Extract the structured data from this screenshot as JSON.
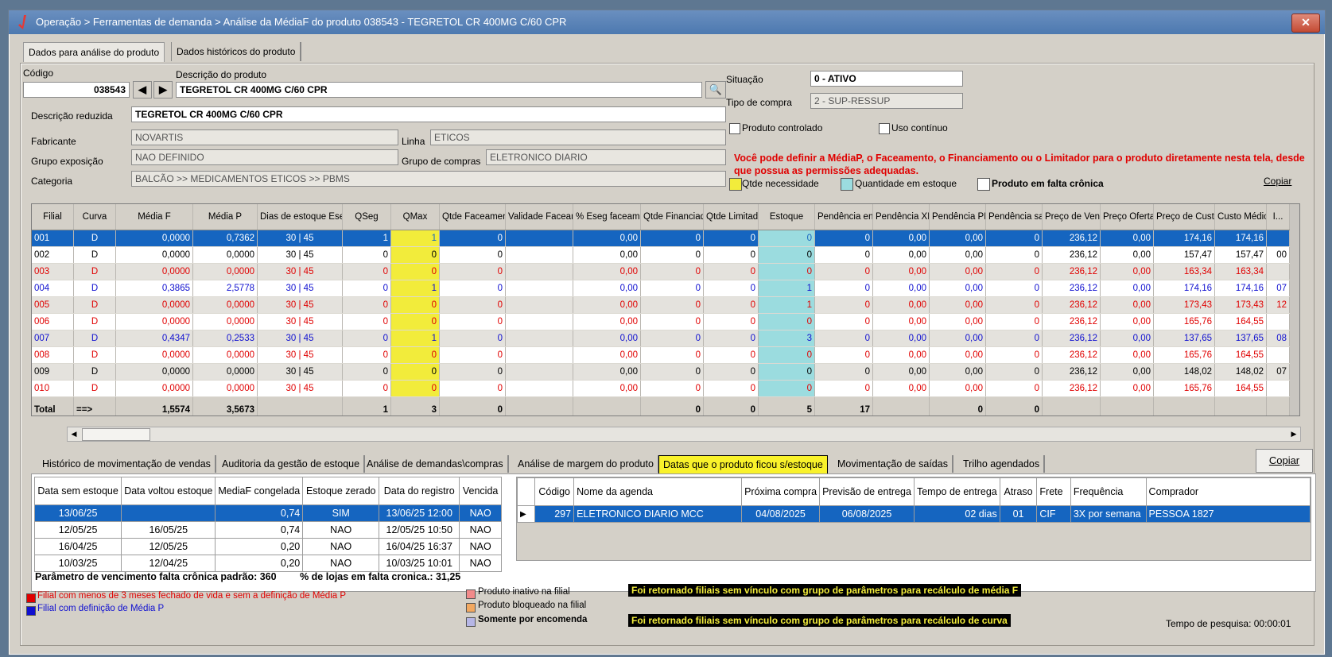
{
  "window": {
    "title": "Operação > Ferramentas de demanda > Análise da MédiaF do produto 038543 - TEGRETOL CR 400MG C/60 CPR",
    "close_label": "✕"
  },
  "top_tabs": [
    "Dados para análise do produto",
    "Dados históricos do produto"
  ],
  "product": {
    "codigo_label": "Código",
    "codigo": "038543",
    "descricao_label": "Descrição do produto",
    "descricao": "TEGRETOL CR 400MG C/60 CPR",
    "descricao_reduzida_label": "Descrição reduzida",
    "descricao_reduzida": "TEGRETOL CR 400MG C/60 CPR",
    "fabricante_label": "Fabricante",
    "fabricante": "NOVARTIS",
    "linha_label": "Linha",
    "linha": "ETICOS",
    "grupo_exposicao_label": "Grupo exposição",
    "grupo_exposicao": "NAO DEFINIDO",
    "grupo_compras_label": "Grupo de compras",
    "grupo_compras": "ELETRONICO DIARIO",
    "categoria_label": "Categoria",
    "categoria": "BALCÃO >> MEDICAMENTOS ETICOS >> PBMS",
    "situacao_label": "Situação",
    "situacao": "0 - ATIVO",
    "tipo_compra_label": "Tipo de compra",
    "tipo_compra": "2 - SUP-RESSUP",
    "produto_controlado_label": "Produto controlado",
    "produto_controlado_checked": false,
    "uso_continuo_label": "Uso contínuo",
    "uso_continuo_checked": false
  },
  "warning_text": "Você pode definir a MédiaP, o Faceamento, o Financiamento ou o Limitador para o produto diretamente nesta tela, desde que possua as permissões adequadas.",
  "grid_legend": {
    "qtde_necessidade": "Qtde necessidade",
    "quantidade_estoque": "Quantidade em estoque",
    "produto_falta": "Produto em falta crônica",
    "copiar": "Copiar",
    "yellow": "#f2ec3b",
    "cyan": "#9bdcdf"
  },
  "grid": {
    "columns": [
      "Filial",
      "Curva",
      "Média F",
      "Média P",
      "Dias de estoque Eseg | Emax",
      "QSeg",
      "QMax",
      "Qtde Faceamento",
      "Validade Faceamento",
      "% Eseg faceamento",
      "Qtde Financiado",
      "Qtde Limitada",
      "Estoque",
      "Pendência entrada",
      "Pendência XML",
      "Pendência PBM",
      "Pendência saída",
      "Preço de Venda",
      "Preço Oferta",
      "Preço de Custo",
      "Custo Médio",
      "I..."
    ],
    "rows": [
      {
        "color": "sel",
        "cells": [
          "001",
          "D",
          "0,0000",
          "0,7362",
          "30  |  45",
          "1",
          "1",
          "0",
          "",
          "0,00",
          "0",
          "0",
          "0",
          "0",
          "0,00",
          "0,00",
          "0",
          "236,12",
          "0,00",
          "174,16",
          "174,16",
          ""
        ]
      },
      {
        "color": "black",
        "cells": [
          "002",
          "D",
          "0,0000",
          "0,0000",
          "30  |  45",
          "0",
          "0",
          "0",
          "",
          "0,00",
          "0",
          "0",
          "0",
          "0",
          "0,00",
          "0,00",
          "0",
          "236,12",
          "0,00",
          "157,47",
          "157,47",
          "00"
        ]
      },
      {
        "color": "red",
        "cells": [
          "003",
          "D",
          "0,0000",
          "0,0000",
          "30  |  45",
          "0",
          "0",
          "0",
          "",
          "0,00",
          "0",
          "0",
          "0",
          "0",
          "0,00",
          "0,00",
          "0",
          "236,12",
          "0,00",
          "163,34",
          "163,34",
          ""
        ]
      },
      {
        "color": "blue",
        "cells": [
          "004",
          "D",
          "0,3865",
          "2,5778",
          "30  |  45",
          "0",
          "1",
          "0",
          "",
          "0,00",
          "0",
          "0",
          "1",
          "0",
          "0,00",
          "0,00",
          "0",
          "236,12",
          "0,00",
          "174,16",
          "174,16",
          "07"
        ]
      },
      {
        "color": "red",
        "cells": [
          "005",
          "D",
          "0,0000",
          "0,0000",
          "30  |  45",
          "0",
          "0",
          "0",
          "",
          "0,00",
          "0",
          "0",
          "1",
          "0",
          "0,00",
          "0,00",
          "0",
          "236,12",
          "0,00",
          "173,43",
          "173,43",
          "12"
        ]
      },
      {
        "color": "red",
        "cells": [
          "006",
          "D",
          "0,0000",
          "0,0000",
          "30  |  45",
          "0",
          "0",
          "0",
          "",
          "0,00",
          "0",
          "0",
          "0",
          "0",
          "0,00",
          "0,00",
          "0",
          "236,12",
          "0,00",
          "165,76",
          "164,55",
          ""
        ]
      },
      {
        "color": "blue",
        "cells": [
          "007",
          "D",
          "0,4347",
          "0,2533",
          "30  |  45",
          "0",
          "1",
          "0",
          "",
          "0,00",
          "0",
          "0",
          "3",
          "0",
          "0,00",
          "0,00",
          "0",
          "236,12",
          "0,00",
          "137,65",
          "137,65",
          "08"
        ]
      },
      {
        "color": "red",
        "cells": [
          "008",
          "D",
          "0,0000",
          "0,0000",
          "30  |  45",
          "0",
          "0",
          "0",
          "",
          "0,00",
          "0",
          "0",
          "0",
          "0",
          "0,00",
          "0,00",
          "0",
          "236,12",
          "0,00",
          "165,76",
          "164,55",
          ""
        ]
      },
      {
        "color": "black",
        "cells": [
          "009",
          "D",
          "0,0000",
          "0,0000",
          "30  |  45",
          "0",
          "0",
          "0",
          "",
          "0,00",
          "0",
          "0",
          "0",
          "0",
          "0,00",
          "0,00",
          "0",
          "236,12",
          "0,00",
          "148,02",
          "148,02",
          "07"
        ]
      },
      {
        "color": "red",
        "cells": [
          "010",
          "D",
          "0,0000",
          "0,0000",
          "30  |  45",
          "0",
          "0",
          "0",
          "",
          "0,00",
          "0",
          "0",
          "0",
          "0",
          "0,00",
          "0,00",
          "0",
          "236,12",
          "0,00",
          "165,76",
          "164,55",
          ""
        ]
      }
    ],
    "totals": [
      "Total",
      "==>",
      "1,5574",
      "3,5673",
      "",
      "1",
      "3",
      "0",
      "",
      "",
      "0",
      "0",
      "5",
      "17",
      "",
      "0",
      "0",
      "",
      "",
      "",
      "",
      ""
    ]
  },
  "lower_tabs": [
    "Histórico de movimentação de vendas",
    "Auditoria da gestão de estoque",
    "Análise de demandas\\compras",
    "Análise de margem do produto",
    "Datas que o produto ficou s/estoque",
    "Movimentação de saídas",
    "Trilho agendados"
  ],
  "lower_active_tab": 4,
  "lower_copy": "Copiar",
  "stock_table": {
    "columns": [
      "Data sem estoque",
      "Data voltou estoque",
      "MediaF congelada",
      "Estoque zerado",
      "Data do registro",
      "Vencida"
    ],
    "rows": [
      [
        "13/06/25",
        "",
        "0,74",
        "SIM",
        "13/06/25 12:00",
        "NAO"
      ],
      [
        "12/05/25",
        "16/05/25",
        "0,74",
        "NAO",
        "12/05/25 10:50",
        "NAO"
      ],
      [
        "16/04/25",
        "12/05/25",
        "0,20",
        "NAO",
        "16/04/25 16:37",
        "NAO"
      ],
      [
        "10/03/25",
        "12/04/25",
        "0,20",
        "NAO",
        "10/03/25 10:01",
        "NAO"
      ]
    ],
    "param_text": "Parâmetro de vencimento falta crônica padrão: 360",
    "pct_text": "% de lojas em falta cronica.: 31,25"
  },
  "agenda_table": {
    "columns": [
      "Código",
      "Nome da agenda",
      "Próxima compra",
      "Previsão de entrega",
      "Tempo de entrega",
      "Atraso",
      "Frete",
      "Frequência",
      "Comprador"
    ],
    "rows": [
      [
        "297",
        "ELETRONICO DIARIO MCC",
        "04/08/2025",
        "06/08/2025",
        "02 dias",
        "01",
        "CIF",
        "3X por semana",
        "PESSOA 1827"
      ]
    ]
  },
  "footer": {
    "legend_red": "Filial com menos de 3 meses fechado de vida e sem a definição de Média P",
    "legend_blue": "Filial com definição de Média P",
    "inativo": "Produto inativo na filial",
    "bloqueado": "Produto bloqueado na filial",
    "encomenda": "Somente por encomenda",
    "msg1": "Foi retornado filiais sem vínculo com grupo de parâmetros para recálculo de média F",
    "msg2": "Foi retornado filiais sem vínculo com grupo de parâmetros para recálculo de curva",
    "tempo": "Tempo de pesquisa: 00:00:01",
    "color_red": "#e00000",
    "color_blue": "#1010d0"
  }
}
